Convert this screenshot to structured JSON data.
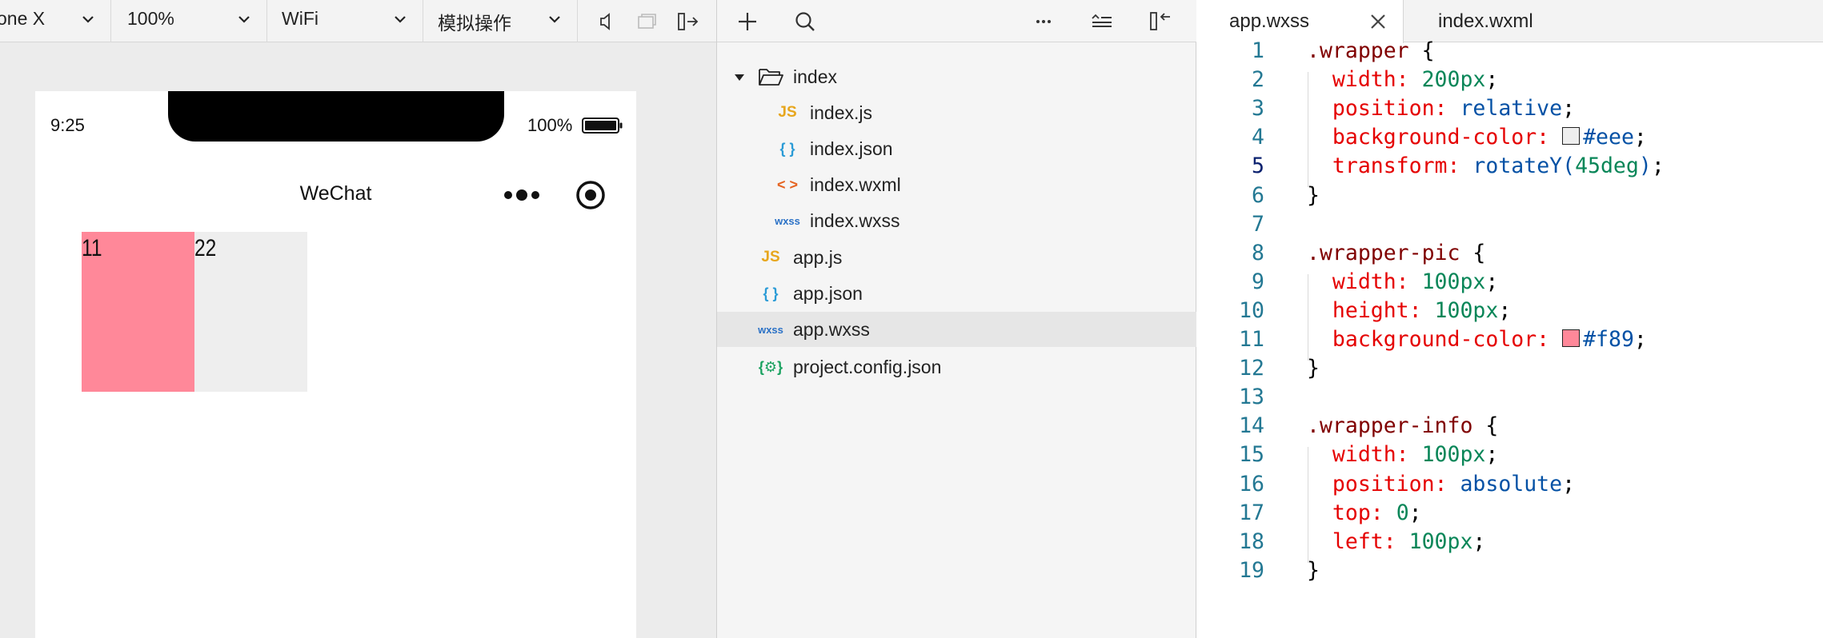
{
  "simulator": {
    "toolbar": {
      "device": "one X",
      "zoom": "100%",
      "network": "WiFi",
      "operation": "模拟操作"
    },
    "status": {
      "time": "9:25",
      "battery": "100%"
    },
    "nav": {
      "title": "WeChat"
    },
    "content": {
      "box1_text": "11",
      "box2_text": "22",
      "box1_color": "#ff8899",
      "box2_color": "#eeeeee"
    }
  },
  "explorer": {
    "tree": [
      {
        "name": "index",
        "type": "folder",
        "icon": "folder-open-icon"
      },
      {
        "name": "index.js",
        "type": "js",
        "icon_text": "JS",
        "icon_color": "#e7a61d"
      },
      {
        "name": "index.json",
        "type": "json",
        "icon_text": "{ }",
        "icon_color": "#2a9bd6"
      },
      {
        "name": "index.wxml",
        "type": "wxml",
        "icon_text": "< >",
        "icon_color": "#e5621f"
      },
      {
        "name": "index.wxss",
        "type": "wxss",
        "icon_text": "wxss",
        "icon_color": "#2a71c6"
      },
      {
        "name": "app.js",
        "type": "js",
        "icon_text": "JS",
        "icon_color": "#e7a61d"
      },
      {
        "name": "app.json",
        "type": "json",
        "icon_text": "{ }",
        "icon_color": "#2a9bd6"
      },
      {
        "name": "app.wxss",
        "type": "wxss",
        "icon_text": "wxss",
        "icon_color": "#2a71c6",
        "selected": true
      },
      {
        "name": "project.config.json",
        "type": "config",
        "icon_text": "{⚙}",
        "icon_color": "#1aa260"
      }
    ]
  },
  "editor": {
    "tabs": [
      {
        "label": "app.wxss",
        "active": true
      },
      {
        "label": "index.wxml",
        "active": false
      }
    ],
    "current_line": 5,
    "lines": [
      [
        {
          "t": ".wrapper",
          "c": "t-sel"
        },
        {
          "t": " {",
          "c": "t-punc"
        }
      ],
      [
        {
          "t": "  width: ",
          "c": "t-prop"
        },
        {
          "t": "200px",
          "c": "t-num"
        },
        {
          "t": ";",
          "c": "t-punc"
        }
      ],
      [
        {
          "t": "  position: ",
          "c": "t-prop"
        },
        {
          "t": "relative",
          "c": "t-kw"
        },
        {
          "t": ";",
          "c": "t-punc"
        }
      ],
      [
        {
          "t": "  background-color: ",
          "c": "t-prop"
        },
        {
          "swatch": "#eeeeee"
        },
        {
          "t": "#eee",
          "c": "t-kw"
        },
        {
          "t": ";",
          "c": "t-punc"
        }
      ],
      [
        {
          "t": "  transform: ",
          "c": "t-prop"
        },
        {
          "t": "rotateY(",
          "c": "t-kw"
        },
        {
          "t": "45deg",
          "c": "t-num"
        },
        {
          "t": ")",
          "c": "t-kw"
        },
        {
          "t": ";",
          "c": "t-punc"
        }
      ],
      [
        {
          "t": "}",
          "c": "t-punc"
        }
      ],
      [],
      [
        {
          "t": ".wrapper-pic",
          "c": "t-sel"
        },
        {
          "t": " {",
          "c": "t-punc"
        }
      ],
      [
        {
          "t": "  width: ",
          "c": "t-prop"
        },
        {
          "t": "100px",
          "c": "t-num"
        },
        {
          "t": ";",
          "c": "t-punc"
        }
      ],
      [
        {
          "t": "  height: ",
          "c": "t-prop"
        },
        {
          "t": "100px",
          "c": "t-num"
        },
        {
          "t": ";",
          "c": "t-punc"
        }
      ],
      [
        {
          "t": "  background-color: ",
          "c": "t-prop"
        },
        {
          "swatch": "#ff8899"
        },
        {
          "t": "#f89",
          "c": "t-kw"
        },
        {
          "t": ";",
          "c": "t-punc"
        }
      ],
      [
        {
          "t": "}",
          "c": "t-punc"
        }
      ],
      [],
      [
        {
          "t": ".wrapper-info",
          "c": "t-sel"
        },
        {
          "t": " {",
          "c": "t-punc"
        }
      ],
      [
        {
          "t": "  width: ",
          "c": "t-prop"
        },
        {
          "t": "100px",
          "c": "t-num"
        },
        {
          "t": ";",
          "c": "t-punc"
        }
      ],
      [
        {
          "t": "  position: ",
          "c": "t-prop"
        },
        {
          "t": "absolute",
          "c": "t-kw"
        },
        {
          "t": ";",
          "c": "t-punc"
        }
      ],
      [
        {
          "t": "  top: ",
          "c": "t-prop"
        },
        {
          "t": "0",
          "c": "t-num"
        },
        {
          "t": ";",
          "c": "t-punc"
        }
      ],
      [
        {
          "t": "  left: ",
          "c": "t-prop"
        },
        {
          "t": "100px",
          "c": "t-num"
        },
        {
          "t": ";",
          "c": "t-punc"
        }
      ],
      [
        {
          "t": "}",
          "c": "t-punc"
        }
      ]
    ]
  }
}
